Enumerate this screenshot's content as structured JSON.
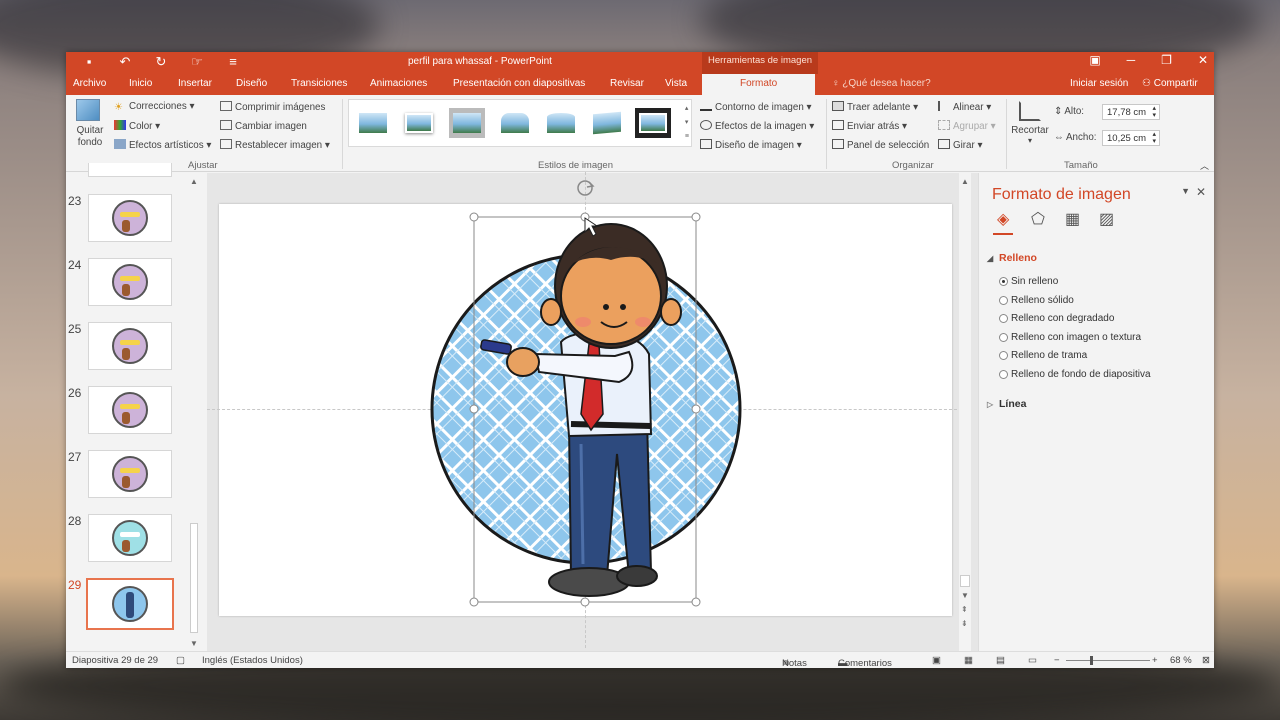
{
  "window": {
    "title": "perfil para whassaf - PowerPoint",
    "context_group": "Herramientas de imagen",
    "qat_icons": [
      "save-icon",
      "undo-icon",
      "redo-icon",
      "touch-icon",
      "customize-icon"
    ]
  },
  "tabs": [
    "Archivo",
    "Inicio",
    "Insertar",
    "Diseño",
    "Transiciones",
    "Animaciones",
    "Presentación con diapositivas",
    "Revisar",
    "Vista",
    "Formato"
  ],
  "active_tab": "Formato",
  "tell_me": "¿Qué desea hacer?",
  "sign_in": "Iniciar sesión",
  "share": "Compartir",
  "ribbon": {
    "ajustar": {
      "remove_bg": "Quitar fondo",
      "corrections": "Correcciones",
      "color": "Color",
      "artistic": "Efectos artísticos",
      "compress": "Comprimir imágenes",
      "change": "Cambiar imagen",
      "reset": "Restablecer imagen",
      "label": "Ajustar"
    },
    "estilos": {
      "label": "Estilos de imagen",
      "border": "Contorno de imagen",
      "effects": "Efectos de la imagen",
      "layout": "Diseño de imagen"
    },
    "organizar": {
      "bring_forward": "Traer adelante",
      "send_backward": "Enviar atrás",
      "selection_pane": "Panel de selección",
      "align": "Alinear",
      "group": "Agrupar",
      "rotate": "Girar",
      "label": "Organizar"
    },
    "tamano": {
      "crop": "Recortar",
      "height_label": "Alto:",
      "height_value": "17,78 cm",
      "width_label": "Ancho:",
      "width_value": "10,25 cm",
      "label": "Tamaño"
    }
  },
  "slides": [
    {
      "num": "23",
      "selected": false
    },
    {
      "num": "24",
      "selected": false
    },
    {
      "num": "25",
      "selected": false
    },
    {
      "num": "26",
      "selected": false
    },
    {
      "num": "27",
      "selected": false
    },
    {
      "num": "28",
      "selected": false
    },
    {
      "num": "29",
      "selected": true
    }
  ],
  "format_pane": {
    "title": "Formato de imagen",
    "fill_section": "Relleno",
    "fill_options": [
      "Sin relleno",
      "Relleno sólido",
      "Relleno con degradado",
      "Relleno con imagen o textura",
      "Relleno de trama",
      "Relleno de fondo de diapositiva"
    ],
    "selected_option": "Sin relleno",
    "line_section": "Línea"
  },
  "status": {
    "slide_info": "Diapositiva 29 de 29",
    "language": "Inglés (Estados Unidos)",
    "notes": "Notas",
    "comments": "Comentarios",
    "zoom": "68 %"
  },
  "colors": {
    "accent": "#d24726",
    "circle_fill": "#8ec6ec",
    "pattern_lines": "#ffffff"
  }
}
